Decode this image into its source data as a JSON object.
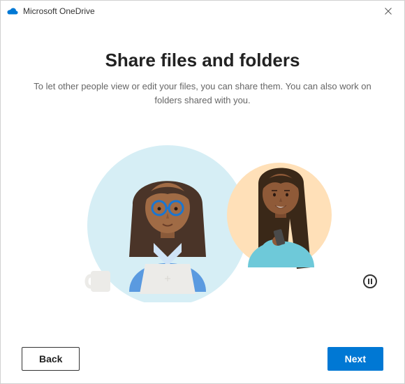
{
  "titlebar": {
    "title": "Microsoft OneDrive"
  },
  "page": {
    "title": "Share files and folders",
    "subtitle": "To let other people view or edit your files, you can share them. You can also work on folders shared with you."
  },
  "footer": {
    "back_label": "Back",
    "next_label": "Next"
  }
}
